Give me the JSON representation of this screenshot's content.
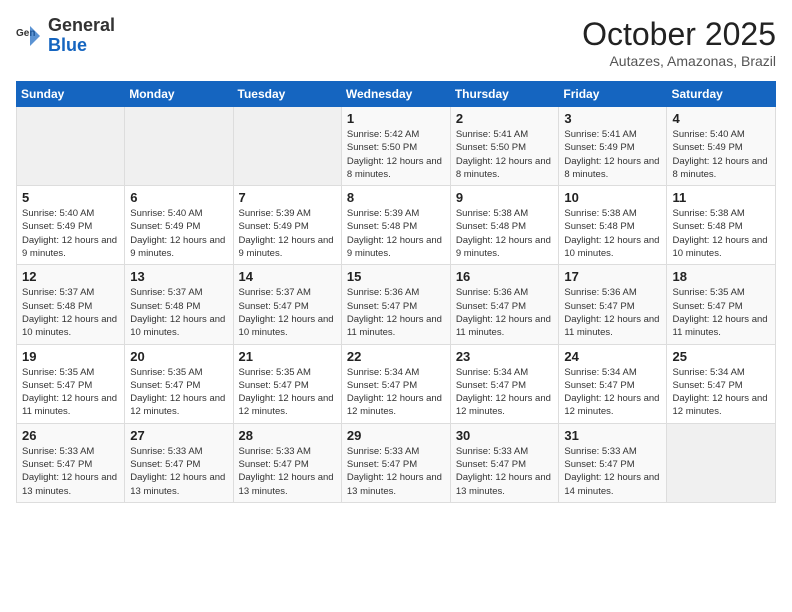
{
  "header": {
    "logo_general": "General",
    "logo_blue": "Blue",
    "month_title": "October 2025",
    "location": "Autazes, Amazonas, Brazil"
  },
  "weekdays": [
    "Sunday",
    "Monday",
    "Tuesday",
    "Wednesday",
    "Thursday",
    "Friday",
    "Saturday"
  ],
  "weeks": [
    [
      {
        "day": "",
        "info": ""
      },
      {
        "day": "",
        "info": ""
      },
      {
        "day": "",
        "info": ""
      },
      {
        "day": "1",
        "info": "Sunrise: 5:42 AM\nSunset: 5:50 PM\nDaylight: 12 hours and 8 minutes."
      },
      {
        "day": "2",
        "info": "Sunrise: 5:41 AM\nSunset: 5:50 PM\nDaylight: 12 hours and 8 minutes."
      },
      {
        "day": "3",
        "info": "Sunrise: 5:41 AM\nSunset: 5:49 PM\nDaylight: 12 hours and 8 minutes."
      },
      {
        "day": "4",
        "info": "Sunrise: 5:40 AM\nSunset: 5:49 PM\nDaylight: 12 hours and 8 minutes."
      }
    ],
    [
      {
        "day": "5",
        "info": "Sunrise: 5:40 AM\nSunset: 5:49 PM\nDaylight: 12 hours and 9 minutes."
      },
      {
        "day": "6",
        "info": "Sunrise: 5:40 AM\nSunset: 5:49 PM\nDaylight: 12 hours and 9 minutes."
      },
      {
        "day": "7",
        "info": "Sunrise: 5:39 AM\nSunset: 5:49 PM\nDaylight: 12 hours and 9 minutes."
      },
      {
        "day": "8",
        "info": "Sunrise: 5:39 AM\nSunset: 5:48 PM\nDaylight: 12 hours and 9 minutes."
      },
      {
        "day": "9",
        "info": "Sunrise: 5:38 AM\nSunset: 5:48 PM\nDaylight: 12 hours and 9 minutes."
      },
      {
        "day": "10",
        "info": "Sunrise: 5:38 AM\nSunset: 5:48 PM\nDaylight: 12 hours and 10 minutes."
      },
      {
        "day": "11",
        "info": "Sunrise: 5:38 AM\nSunset: 5:48 PM\nDaylight: 12 hours and 10 minutes."
      }
    ],
    [
      {
        "day": "12",
        "info": "Sunrise: 5:37 AM\nSunset: 5:48 PM\nDaylight: 12 hours and 10 minutes."
      },
      {
        "day": "13",
        "info": "Sunrise: 5:37 AM\nSunset: 5:48 PM\nDaylight: 12 hours and 10 minutes."
      },
      {
        "day": "14",
        "info": "Sunrise: 5:37 AM\nSunset: 5:47 PM\nDaylight: 12 hours and 10 minutes."
      },
      {
        "day": "15",
        "info": "Sunrise: 5:36 AM\nSunset: 5:47 PM\nDaylight: 12 hours and 11 minutes."
      },
      {
        "day": "16",
        "info": "Sunrise: 5:36 AM\nSunset: 5:47 PM\nDaylight: 12 hours and 11 minutes."
      },
      {
        "day": "17",
        "info": "Sunrise: 5:36 AM\nSunset: 5:47 PM\nDaylight: 12 hours and 11 minutes."
      },
      {
        "day": "18",
        "info": "Sunrise: 5:35 AM\nSunset: 5:47 PM\nDaylight: 12 hours and 11 minutes."
      }
    ],
    [
      {
        "day": "19",
        "info": "Sunrise: 5:35 AM\nSunset: 5:47 PM\nDaylight: 12 hours and 11 minutes."
      },
      {
        "day": "20",
        "info": "Sunrise: 5:35 AM\nSunset: 5:47 PM\nDaylight: 12 hours and 12 minutes."
      },
      {
        "day": "21",
        "info": "Sunrise: 5:35 AM\nSunset: 5:47 PM\nDaylight: 12 hours and 12 minutes."
      },
      {
        "day": "22",
        "info": "Sunrise: 5:34 AM\nSunset: 5:47 PM\nDaylight: 12 hours and 12 minutes."
      },
      {
        "day": "23",
        "info": "Sunrise: 5:34 AM\nSunset: 5:47 PM\nDaylight: 12 hours and 12 minutes."
      },
      {
        "day": "24",
        "info": "Sunrise: 5:34 AM\nSunset: 5:47 PM\nDaylight: 12 hours and 12 minutes."
      },
      {
        "day": "25",
        "info": "Sunrise: 5:34 AM\nSunset: 5:47 PM\nDaylight: 12 hours and 12 minutes."
      }
    ],
    [
      {
        "day": "26",
        "info": "Sunrise: 5:33 AM\nSunset: 5:47 PM\nDaylight: 12 hours and 13 minutes."
      },
      {
        "day": "27",
        "info": "Sunrise: 5:33 AM\nSunset: 5:47 PM\nDaylight: 12 hours and 13 minutes."
      },
      {
        "day": "28",
        "info": "Sunrise: 5:33 AM\nSunset: 5:47 PM\nDaylight: 12 hours and 13 minutes."
      },
      {
        "day": "29",
        "info": "Sunrise: 5:33 AM\nSunset: 5:47 PM\nDaylight: 12 hours and 13 minutes."
      },
      {
        "day": "30",
        "info": "Sunrise: 5:33 AM\nSunset: 5:47 PM\nDaylight: 12 hours and 13 minutes."
      },
      {
        "day": "31",
        "info": "Sunrise: 5:33 AM\nSunset: 5:47 PM\nDaylight: 12 hours and 14 minutes."
      },
      {
        "day": "",
        "info": ""
      }
    ]
  ]
}
